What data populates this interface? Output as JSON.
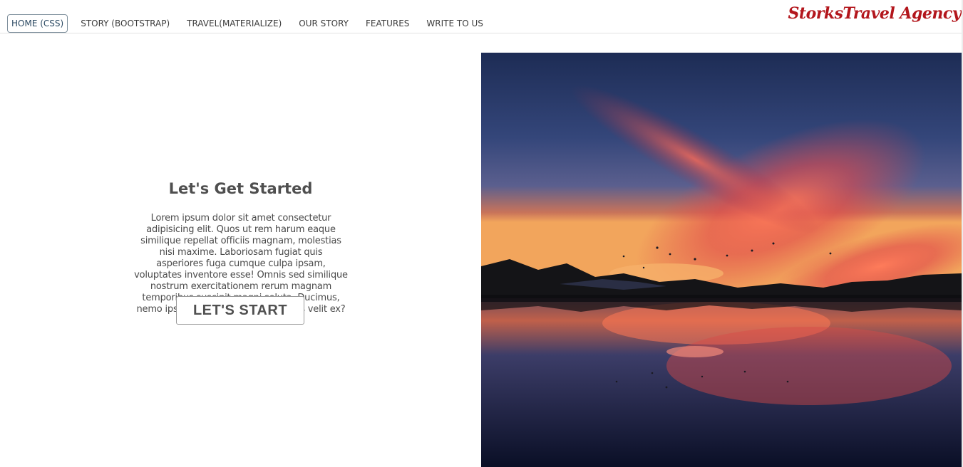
{
  "navbar": {
    "links": [
      "HOME (CSS)",
      "STORY (BOOTSTRAP)",
      "TRAVEL(MATERIALIZE)",
      "OUR STORY",
      "FEATURES",
      "WRITE TO US"
    ],
    "active_index": 0,
    "brand": "StorksTravel Agency"
  },
  "hero": {
    "title": "Let's Get Started",
    "paragraph_lines": [
      "Lorem ipsum dolor sit amet consectetur",
      "adipisicing elit. Quos ut rem harum eaque",
      "similique repellat officiis magnam, molestias",
      "nisi maxime. Laboriosam fugiat quis",
      "asperiores fuga cumque culpa ipsam,",
      "voluptates inventore esse! Omnis sed similique",
      "nostrum exercitationem rerum magnam",
      "temporibus suscipit magni soluta. Ducimus,",
      "nemo ipsam laboriosam ea molestias velit ex?"
    ],
    "button_label": "LET'S START",
    "image_icon": "sunset-lake-photo"
  },
  "colors": {
    "brand": "#b3161c",
    "active_nav": "#2c4a63",
    "text": "#4f4f4f"
  }
}
